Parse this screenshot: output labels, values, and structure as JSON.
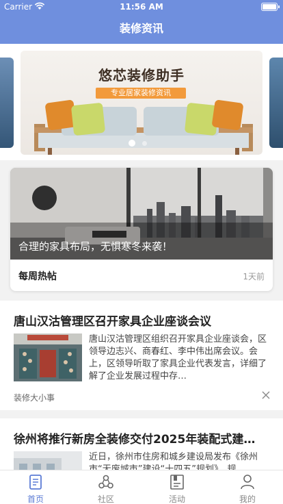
{
  "status_bar": {
    "carrier": "Carrier",
    "time": "11:56 AM"
  },
  "nav": {
    "title": "装修资讯"
  },
  "banner": {
    "title": "悠芯装修助手",
    "subtitle": "专业居家装修资讯",
    "page_count": 2,
    "current_page": 1
  },
  "hot_post": {
    "caption": "合理的家具布局，无惧寒冬来袭！",
    "label": "每周热帖",
    "time": "1天前"
  },
  "articles": [
    {
      "title": "唐山汉沽管理区召开家具企业座谈会议",
      "summary": "唐山汉沽管理区组织召开家具企业座谈会，区领导边志兴、商春红、李中伟出席会议。会上，区领导听取了家具企业代表发言，详细了解了企业发展过程中存…",
      "source": "装修大小事"
    },
    {
      "title": "徐州将推行新房全装修交付2025年装配式建…",
      "summary": "近日，徐州市住房和城乡建设局发布《徐州市“无废城市”建设“十四五”规划》，规",
      "source": ""
    }
  ],
  "tabs": [
    {
      "label": "首页",
      "icon": "home-doc-icon",
      "active": true
    },
    {
      "label": "社区",
      "icon": "community-icon",
      "active": false
    },
    {
      "label": "活动",
      "icon": "activity-icon",
      "active": false
    },
    {
      "label": "我的",
      "icon": "profile-icon",
      "active": false
    }
  ],
  "colors": {
    "primary": "#6f8fde",
    "tab_active": "#5b7bd5",
    "badge_orange": "#f29a3b"
  }
}
